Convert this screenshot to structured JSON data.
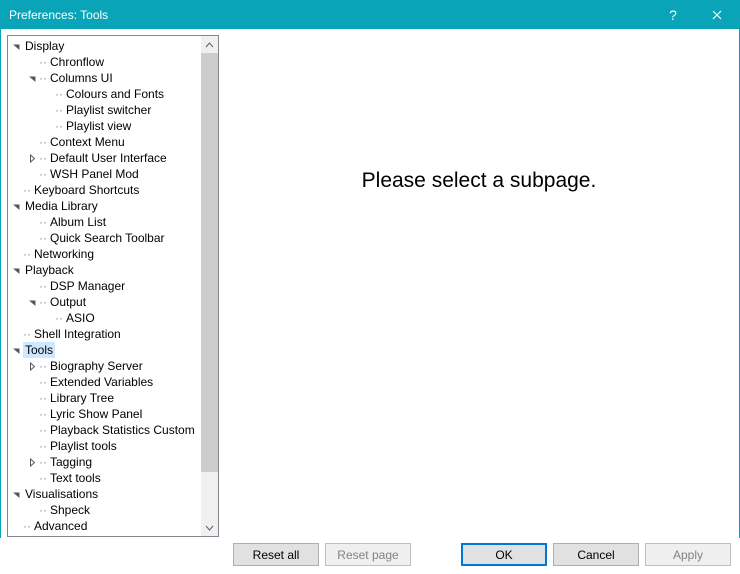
{
  "window": {
    "title": "Preferences: Tools"
  },
  "content": {
    "placeholder": "Please select a subpage."
  },
  "buttons": {
    "reset_all": "Reset all",
    "reset_page": "Reset page",
    "ok": "OK",
    "cancel": "Cancel",
    "apply": "Apply"
  },
  "tree": [
    {
      "id": "display",
      "level": 0,
      "expander": "down",
      "label": "Display"
    },
    {
      "id": "chronflow",
      "level": 1,
      "expander": "none",
      "label": "Chronflow"
    },
    {
      "id": "columns-ui",
      "level": 1,
      "expander": "down",
      "label": "Columns UI"
    },
    {
      "id": "colours-fonts",
      "level": 2,
      "expander": "none",
      "label": "Colours and Fonts"
    },
    {
      "id": "playlist-switcher",
      "level": 2,
      "expander": "none",
      "label": "Playlist switcher"
    },
    {
      "id": "playlist-view",
      "level": 2,
      "expander": "none",
      "label": "Playlist view"
    },
    {
      "id": "context-menu",
      "level": 1,
      "expander": "none",
      "label": "Context Menu"
    },
    {
      "id": "default-ui",
      "level": 1,
      "expander": "right",
      "label": "Default User Interface"
    },
    {
      "id": "wsh-panel",
      "level": 1,
      "expander": "none",
      "label": "WSH Panel Mod"
    },
    {
      "id": "kb-shortcuts",
      "level": 0,
      "expander": "leaf",
      "label": "Keyboard Shortcuts"
    },
    {
      "id": "media-library",
      "level": 0,
      "expander": "down",
      "label": "Media Library"
    },
    {
      "id": "album-list",
      "level": 1,
      "expander": "none",
      "label": "Album List"
    },
    {
      "id": "quick-search",
      "level": 1,
      "expander": "none",
      "label": "Quick Search Toolbar"
    },
    {
      "id": "networking",
      "level": 0,
      "expander": "leaf",
      "label": "Networking"
    },
    {
      "id": "playback",
      "level": 0,
      "expander": "down",
      "label": "Playback"
    },
    {
      "id": "dsp-manager",
      "level": 1,
      "expander": "none",
      "label": "DSP Manager"
    },
    {
      "id": "output",
      "level": 1,
      "expander": "down",
      "label": "Output"
    },
    {
      "id": "asio",
      "level": 2,
      "expander": "none",
      "label": "ASIO"
    },
    {
      "id": "shell-integration",
      "level": 0,
      "expander": "leaf",
      "label": "Shell Integration"
    },
    {
      "id": "tools",
      "level": 0,
      "expander": "down",
      "label": "Tools",
      "selected": true
    },
    {
      "id": "biography-server",
      "level": 1,
      "expander": "right",
      "label": "Biography Server"
    },
    {
      "id": "extended-vars",
      "level": 1,
      "expander": "none",
      "label": "Extended Variables"
    },
    {
      "id": "library-tree",
      "level": 1,
      "expander": "none",
      "label": "Library Tree"
    },
    {
      "id": "lyric-show",
      "level": 1,
      "expander": "none",
      "label": "Lyric Show Panel"
    },
    {
      "id": "playback-stats",
      "level": 1,
      "expander": "none",
      "label": "Playback Statistics Custom"
    },
    {
      "id": "playlist-tools",
      "level": 1,
      "expander": "none",
      "label": "Playlist tools"
    },
    {
      "id": "tagging",
      "level": 1,
      "expander": "right",
      "label": "Tagging"
    },
    {
      "id": "text-tools",
      "level": 1,
      "expander": "none",
      "label": "Text tools"
    },
    {
      "id": "visualisations",
      "level": 0,
      "expander": "down",
      "label": "Visualisations"
    },
    {
      "id": "shpeck",
      "level": 1,
      "expander": "none",
      "label": "Shpeck"
    },
    {
      "id": "advanced",
      "level": 0,
      "expander": "leaf",
      "label": "Advanced"
    }
  ]
}
